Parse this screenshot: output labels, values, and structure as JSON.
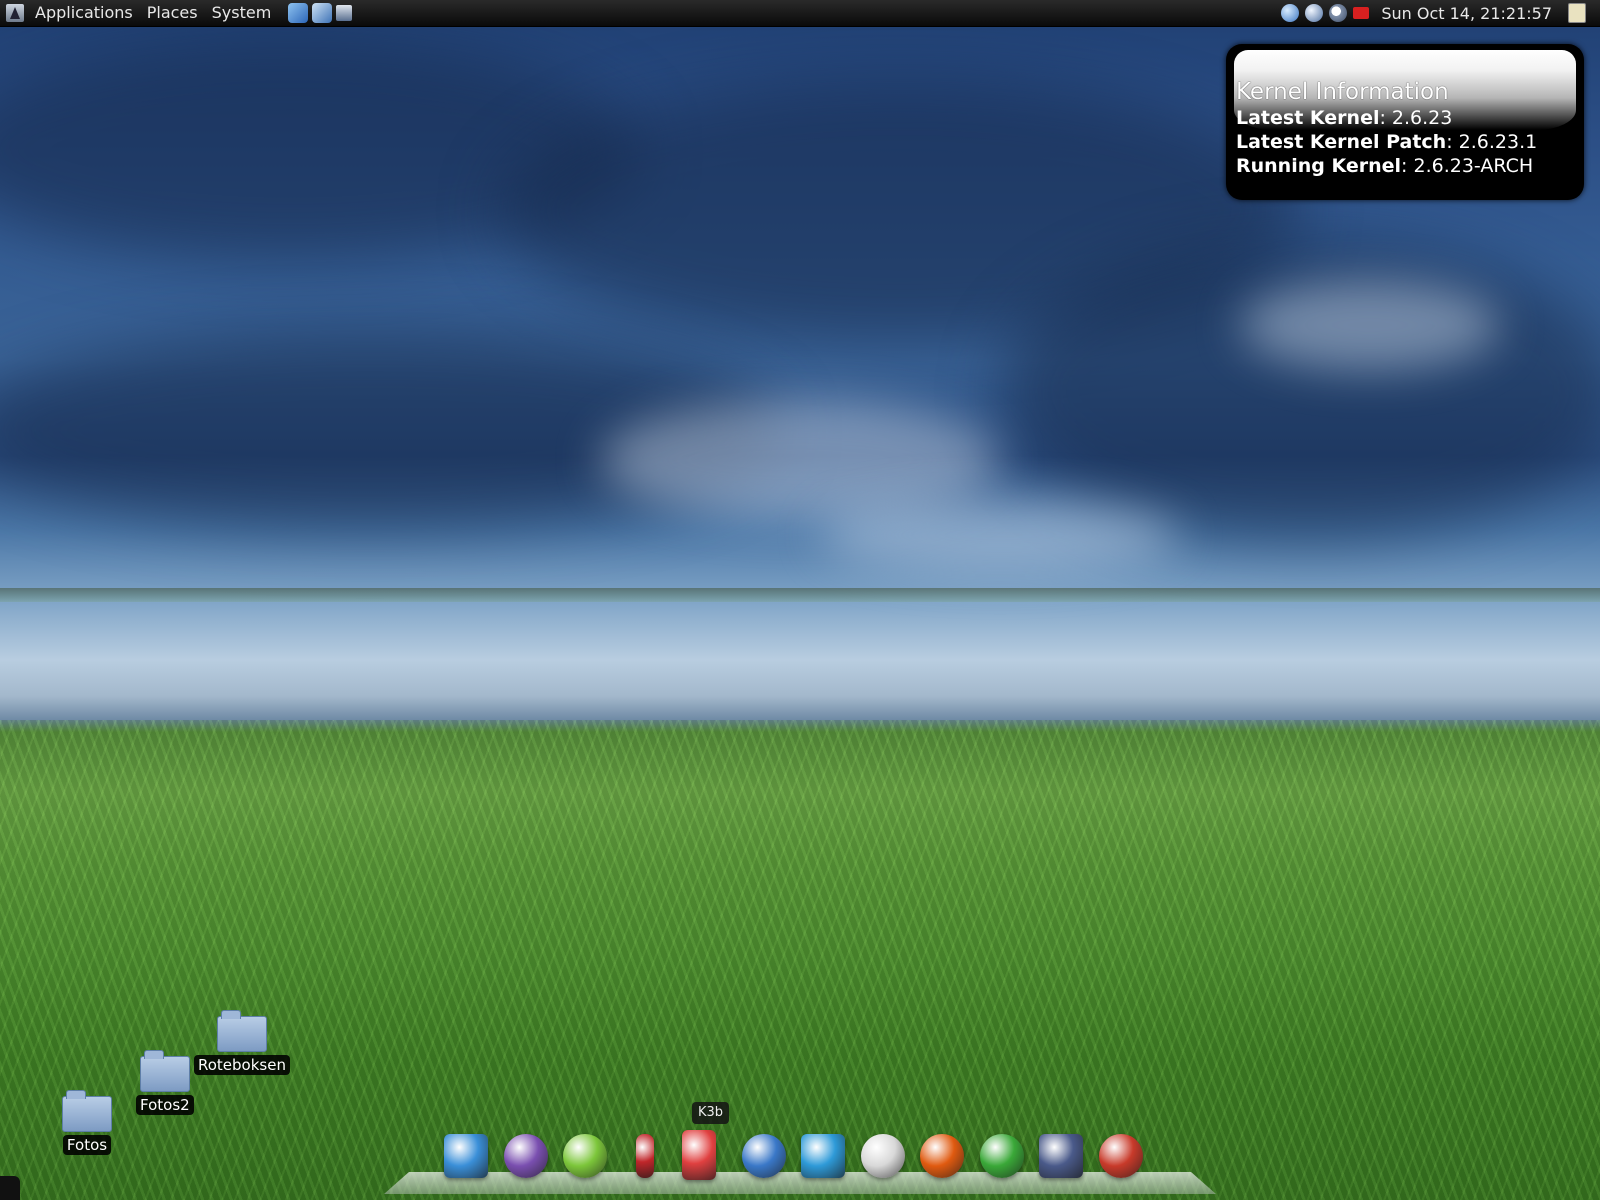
{
  "top_panel": {
    "menus": [
      {
        "label": "Applications"
      },
      {
        "label": "Places"
      },
      {
        "label": "System"
      }
    ],
    "clock": "Sun Oct 14, 21:21:57"
  },
  "kernel_widget": {
    "title": "Kernel Information",
    "rows": [
      {
        "label": "Latest Kernel",
        "value": ": 2.6.23"
      },
      {
        "label": "Latest Kernel Patch",
        "value": ": 2.6.23.1"
      },
      {
        "label": "Running Kernel",
        "value": ": 2.6.23-ARCH"
      }
    ]
  },
  "desktop_icons": [
    {
      "label": "Roteboksen"
    },
    {
      "label": "Fotos2"
    },
    {
      "label": "Fotos"
    }
  ],
  "dock": {
    "tooltip": "K3b",
    "icons": [
      {
        "name": "image-viewer-icon",
        "color": "#3a8fd8"
      },
      {
        "name": "pidgin-icon",
        "color": "#7a4fb0"
      },
      {
        "name": "play-icon",
        "color": "#7cc63a"
      },
      {
        "name": "lipstick-icon",
        "color": "#c0262a"
      },
      {
        "name": "k3b-icon",
        "color": "#e04040"
      },
      {
        "name": "drop-icon",
        "color": "#3a78c8"
      },
      {
        "name": "cursor-icon",
        "color": "#2e9ad8"
      },
      {
        "name": "cards-icon",
        "color": "#d8d8d8"
      },
      {
        "name": "fire-icon",
        "color": "#e05a10"
      },
      {
        "name": "globe-icon",
        "color": "#3aa838"
      },
      {
        "name": "terminal-icon",
        "color": "#4a5a8a"
      },
      {
        "name": "close-icon",
        "color": "#c83a2a"
      }
    ]
  }
}
